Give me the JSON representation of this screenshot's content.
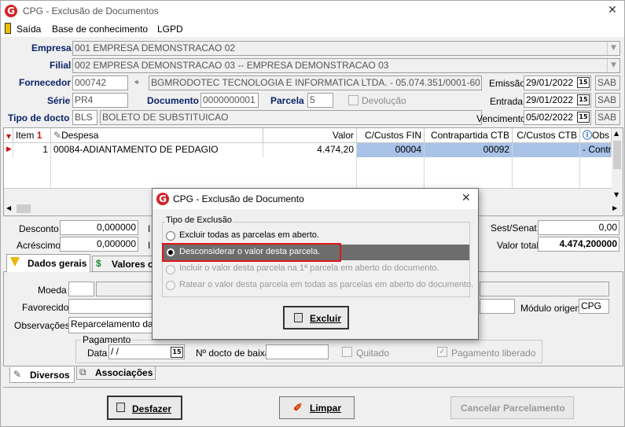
{
  "window": {
    "title": "CPG - Exclusão de Documentos",
    "close": "✕"
  },
  "menu": [
    "Saída",
    "Base de conhecimento",
    "LGPD"
  ],
  "header": {
    "empresa_label": "Empresa",
    "empresa_value": "001 EMPRESA DEMONSTRACAO 02",
    "filial_label": "Filial",
    "filial_value": "002 EMPRESA DEMONSTRACAO 03 -- EMPRESA DEMONSTRACAO 03",
    "fornecedor_label": "Fornecedor",
    "fornecedor_code": "000742",
    "fornecedor_name": "BGMRODOTEC TECNOLOGIA E INFORMATICA LTDA. - 05.074.351/0001-60",
    "serie_label": "Série",
    "serie_value": "PR4",
    "documento_label": "Documento",
    "documento_value": "0000000001",
    "parcela_label": "Parcela",
    "parcela_value": "5",
    "devolucao_label": "Devolução",
    "tipo_label": "Tipo de docto",
    "tipo_code": "BLS",
    "tipo_name": "BOLETO DE SUBSTITUICAO",
    "emissao_label": "Emissão",
    "emissao_value": "29/01/2022",
    "entrada_label": "Entrada",
    "entrada_value": "29/01/2022",
    "vencimento_label": "Vencimento",
    "vencimento_value": "05/02/2022",
    "sab": "SAB"
  },
  "grid": {
    "columns": [
      "Item",
      "Despesa",
      "Valor",
      "C/Custos FIN",
      "Contrapartida CTB",
      "C/Custos CTB",
      "Obs"
    ],
    "rows": [
      {
        "item": "1",
        "despesa": "00084-ADIANTAMENTO DE PEDAGIO",
        "valor": "4.474,20",
        "cc_fin": "00004",
        "contrapartida": "00092",
        "cc_ctb": "",
        "obs": "- Contra"
      }
    ]
  },
  "totals": {
    "desconto_label": "Desconto",
    "desconto_value": "0,000000",
    "acrescimo_label": "Acréscimo",
    "acrescimo_value": "0,000000",
    "ir_label": "I",
    "sest_label": "Sest/Senat",
    "sest_value": "0,00",
    "valor_total_label": "Valor total",
    "valor_total_value": "4.474,200000"
  },
  "tabs": {
    "dados_gerais": "Dados gerais",
    "valores": "Valores c"
  },
  "dados": {
    "moeda_label": "Moeda",
    "favorecido_label": "Favorecido",
    "observacoes_label": "Observações",
    "observacoes_value": "Reparcelamento da pa",
    "modulo_label": "Módulo origem",
    "modulo_value": "CPG",
    "pagamento_group": "Pagamento",
    "data_label": "Data",
    "data_value": " /  /",
    "ndocto_label": "Nº docto de baixa",
    "quitado_label": "Quitado",
    "pagamento_liberado_label": "Pagamento liberado"
  },
  "bottom_tabs": {
    "diversos": "Diversos",
    "associacoes": "Associações"
  },
  "buttons": {
    "desfazer": "Desfazer",
    "limpar": "Limpar",
    "cancelar": "Cancelar Parcelamento"
  },
  "dialog": {
    "title": "CPG - Exclusão de Documento",
    "group": "Tipo de Exclusão",
    "options": [
      "Excluir todas as parcelas em aberto.",
      "Desconsiderar o valor desta  parcela.",
      "Incluir o valor desta parcela na 1ª parcela em aberto do documento.",
      "Ratear o valor desta parcela em todas as parcelas em aberto do documento."
    ],
    "selected": 1,
    "excluir": "Excluir"
  },
  "colors": {
    "selection": "#a9c3e8",
    "dialog_highlight": "#6d6d6d",
    "highlight_border": "#e01818",
    "label_blue": "#0a246a"
  }
}
